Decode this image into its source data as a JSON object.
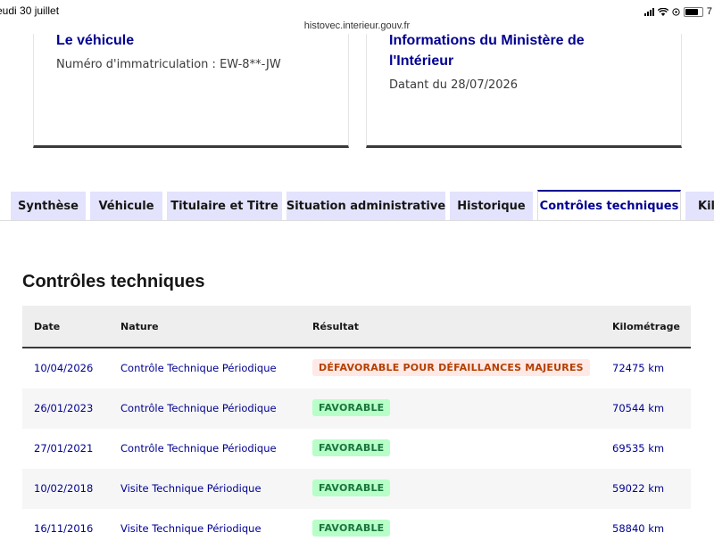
{
  "statusbar": {
    "time": "eudi 30 juillet",
    "url": "histovec.interieur.gouv.fr",
    "battery": "7"
  },
  "cards": {
    "vehicle": {
      "title": "Le véhicule",
      "text": "Numéro d'immatriculation : EW-8**-JW"
    },
    "ministry": {
      "title_line1": "Informations du Ministère de",
      "title_line2": "l'Intérieur",
      "text": "Datant du 28/07/2026"
    }
  },
  "tabs": [
    {
      "label": "Synthèse"
    },
    {
      "label": "Véhicule"
    },
    {
      "label": "Titulaire et Titre"
    },
    {
      "label": "Situation administrative"
    },
    {
      "label": "Historique"
    },
    {
      "label": "Contrôles techniques"
    },
    {
      "label": "Kil"
    }
  ],
  "section": {
    "title": "Contrôles techniques"
  },
  "table": {
    "headers": {
      "date": "Date",
      "nature": "Nature",
      "result": "Résultat",
      "km": "Kilométrage"
    },
    "rows": [
      {
        "date": "10/04/2026",
        "nature": "Contrôle Technique Périodique",
        "result": "DÉFAVORABLE POUR DÉFAILLANCES MAJEURES",
        "km": "72475 km"
      },
      {
        "date": "26/01/2023",
        "nature": "Contrôle Technique Périodique",
        "result": "FAVORABLE",
        "km": "70544 km"
      },
      {
        "date": "27/01/2021",
        "nature": "Contrôle Technique Périodique",
        "result": "FAVORABLE",
        "km": "69535 km"
      },
      {
        "date": "10/02/2018",
        "nature": "Visite Technique Périodique",
        "result": "FAVORABLE",
        "km": "59022 km"
      },
      {
        "date": "16/11/2016",
        "nature": "Visite Technique Périodique",
        "result": "FAVORABLE",
        "km": "58840 km"
      }
    ]
  },
  "colors": {
    "primary": "#000091",
    "tab_bg": "#e3e3fd",
    "badge_bad_bg": "#fee9e6",
    "badge_bad_text": "#b34000",
    "badge_ok_bg": "#b8fec9",
    "badge_ok_text": "#18753c"
  }
}
